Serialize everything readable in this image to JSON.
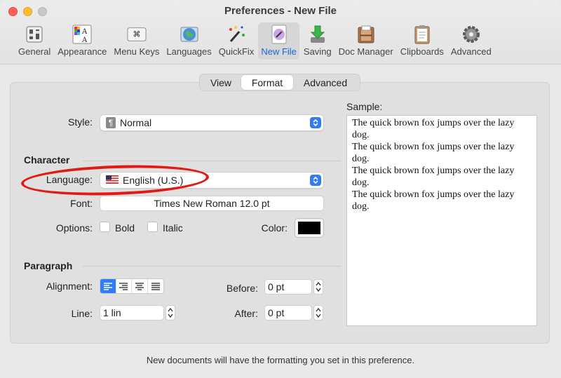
{
  "window": {
    "title": "Preferences - New File"
  },
  "toolbar": {
    "items": [
      {
        "label": "General",
        "icon": "switches-icon"
      },
      {
        "label": "Appearance",
        "icon": "appearance-icon"
      },
      {
        "label": "Menu Keys",
        "icon": "command-key-icon"
      },
      {
        "label": "Languages",
        "icon": "globe-icon"
      },
      {
        "label": "QuickFix",
        "icon": "magic-wand-icon"
      },
      {
        "label": "New File",
        "icon": "new-file-icon",
        "active": true
      },
      {
        "label": "Saving",
        "icon": "download-arrow-icon"
      },
      {
        "label": "Doc Manager",
        "icon": "file-cabinet-icon"
      },
      {
        "label": "Clipboards",
        "icon": "clipboard-icon"
      },
      {
        "label": "Advanced",
        "icon": "gear-icon"
      }
    ]
  },
  "tabs": [
    {
      "label": "View"
    },
    {
      "label": "Format",
      "active": true
    },
    {
      "label": "Advanced"
    }
  ],
  "format": {
    "style_label": "Style:",
    "style_value": "Normal",
    "character_heading": "Character",
    "language_label": "Language:",
    "language_value": "English (U.S.)",
    "font_label": "Font:",
    "font_value": "Times New Roman 12.0 pt",
    "options_label": "Options:",
    "bold_label": "Bold",
    "italic_label": "Italic",
    "color_label": "Color:",
    "color_value": "#000000",
    "paragraph_heading": "Paragraph",
    "alignment_label": "Alignment:",
    "alignment_selected": "left",
    "line_label": "Line:",
    "line_value": "1 lin",
    "before_label": "Before:",
    "before_value": "0 pt",
    "after_label": "After:",
    "after_value": "0 pt"
  },
  "sample": {
    "label": "Sample:",
    "lines": [
      "The quick brown fox jumps over the lazy dog.",
      "The quick brown fox jumps over the lazy dog.",
      "The quick brown fox jumps over the lazy dog.",
      "The quick brown fox jumps over the lazy dog."
    ]
  },
  "footer": {
    "note": "New documents will have the formatting you set in this preference."
  },
  "colors": {
    "accent": "#2f7cf6",
    "annotation": "#e11b14"
  }
}
